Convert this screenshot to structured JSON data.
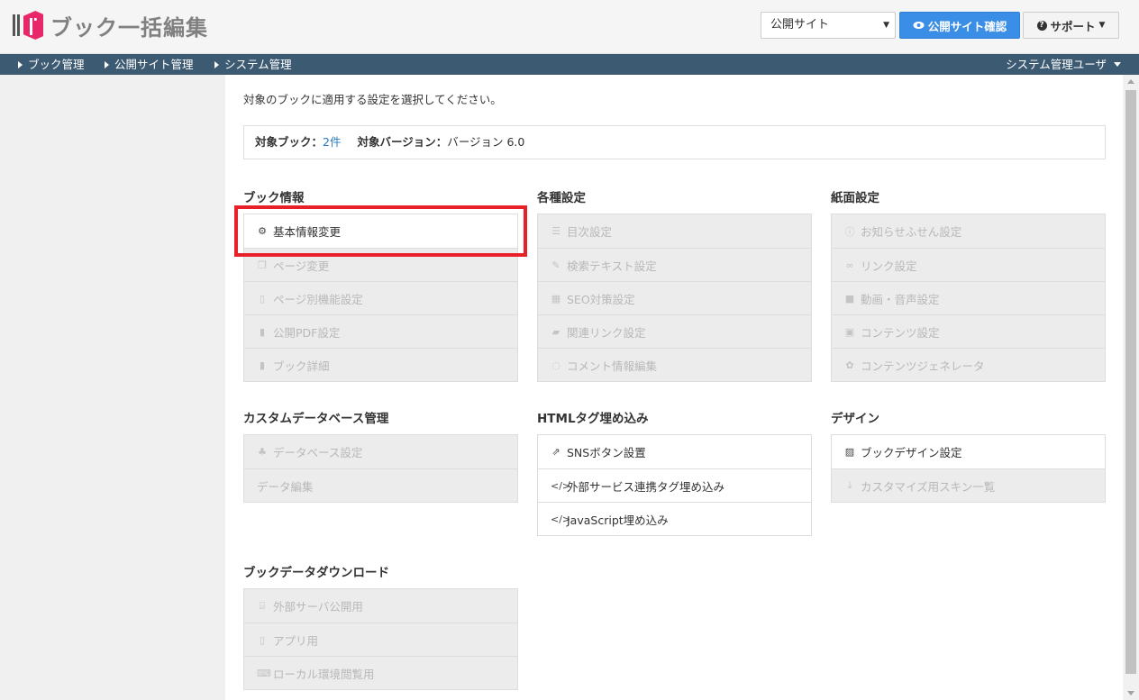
{
  "header": {
    "title": "ブック一括編集",
    "site_select": "公開サイト",
    "confirm_button": "公開サイト確認",
    "support_button": "サポート"
  },
  "nav": {
    "items": [
      "ブック管理",
      "公開サイト管理",
      "システム管理"
    ],
    "user": "システム管理ユーザ"
  },
  "main": {
    "instruction": "対象のブックに適用する設定を選択してください。",
    "target_book_label": "対象ブック：",
    "target_book_value": "2件",
    "target_version_label": "対象バージョン：",
    "target_version_value": "バージョン 6.0"
  },
  "sections": {
    "book_info": {
      "title": "ブック情報",
      "items": [
        "基本情報変更",
        "ページ変更",
        "ページ別機能設定",
        "公開PDF設定",
        "ブック詳細"
      ]
    },
    "various": {
      "title": "各種設定",
      "items": [
        "目次設定",
        "検索テキスト設定",
        "SEO対策設定",
        "関連リンク設定",
        "コメント情報編集"
      ]
    },
    "paper": {
      "title": "紙面設定",
      "items": [
        "お知らせふせん設定",
        "リンク設定",
        "動画・音声設定",
        "コンテンツ設定",
        "コンテンツジェネレータ"
      ]
    },
    "custom_db": {
      "title": "カスタムデータベース管理",
      "items": [
        "データベース設定",
        "データ編集"
      ]
    },
    "html_tag": {
      "title": "HTMLタグ埋め込み",
      "items": [
        "SNSボタン設置",
        "外部サービス連携タグ埋め込み",
        "JavaScript埋め込み"
      ]
    },
    "design": {
      "title": "デザイン",
      "items": [
        "ブックデザイン設定",
        "カスタマイズ用スキン一覧"
      ]
    },
    "download": {
      "title": "ブックデータダウンロード",
      "items": [
        "外部サーバ公開用",
        "アプリ用",
        "ローカル環境閲覧用"
      ]
    }
  },
  "colors": {
    "brand": "#e8266a",
    "nav_bg": "#3d5a73",
    "primary_button": "#3a8ee6",
    "highlight": "#e8202a",
    "link": "#2a7bc0"
  }
}
